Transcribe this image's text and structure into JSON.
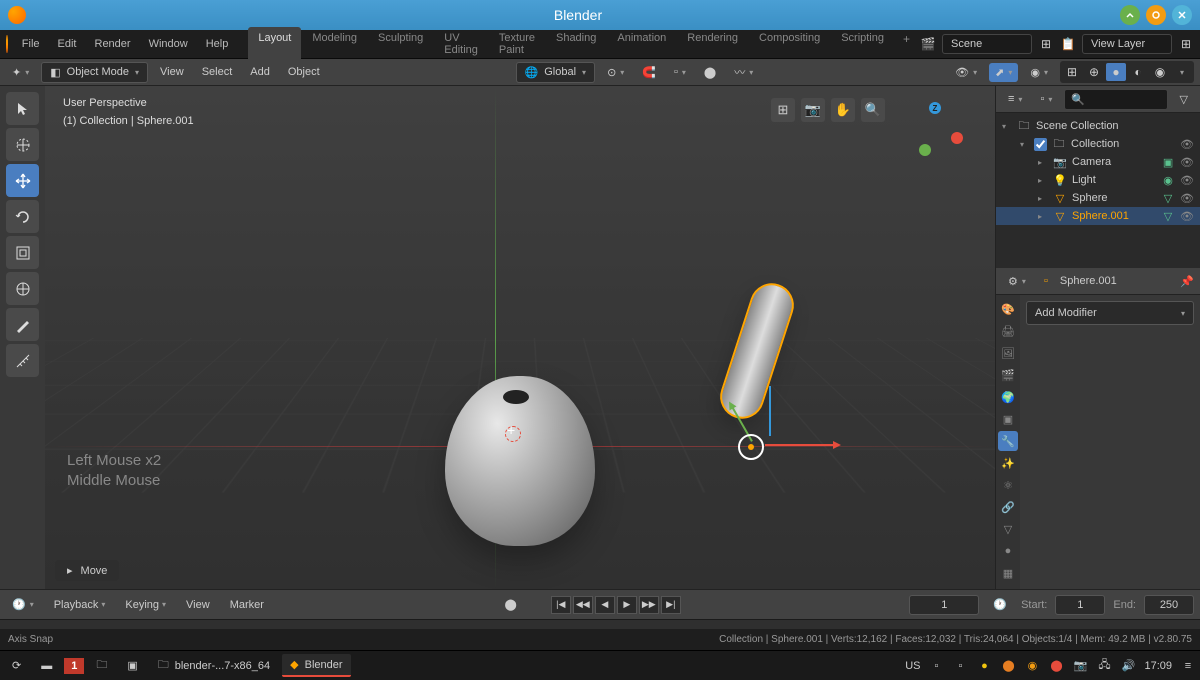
{
  "window": {
    "title": "Blender"
  },
  "menu": {
    "file": "File",
    "edit": "Edit",
    "render": "Render",
    "window": "Window",
    "help": "Help"
  },
  "workspaces": {
    "layout": "Layout",
    "modeling": "Modeling",
    "sculpting": "Sculpting",
    "uv": "UV Editing",
    "texture": "Texture Paint",
    "shading": "Shading",
    "animation": "Animation",
    "rendering": "Rendering",
    "compositing": "Compositing",
    "scripting": "Scripting"
  },
  "scene": {
    "label": "Scene",
    "layer": "View Layer"
  },
  "header": {
    "mode": "Object Mode",
    "view": "View",
    "select": "Select",
    "add": "Add",
    "object": "Object",
    "orientation": "Global"
  },
  "viewport": {
    "perspective": "User Perspective",
    "collection": "(1) Collection | Sphere.001",
    "hint1": "Left Mouse x2",
    "hint2": "Middle Mouse",
    "operator": "Move"
  },
  "outliner": {
    "root": "Scene Collection",
    "collection": "Collection",
    "items": [
      {
        "name": "Camera",
        "type": "camera"
      },
      {
        "name": "Light",
        "type": "light"
      },
      {
        "name": "Sphere",
        "type": "mesh"
      },
      {
        "name": "Sphere.001",
        "type": "mesh",
        "selected": true
      }
    ]
  },
  "properties": {
    "object_name": "Sphere.001",
    "add_modifier": "Add Modifier"
  },
  "timeline": {
    "playback": "Playback",
    "keying": "Keying",
    "view": "View",
    "marker": "Marker",
    "current": "1",
    "start_label": "Start:",
    "start": "1",
    "end_label": "End:",
    "end": "250"
  },
  "status": {
    "left": "Axis Snap",
    "right": "Collection | Sphere.001 | Verts:12,162 | Faces:12,032 | Tris:24,064 | Objects:1/4 | Mem: 49.2 MB | v2.80.75"
  },
  "taskbar": {
    "ws": "1",
    "file_mgr": "blender-...7-x86_64",
    "app": "Blender",
    "lang": "US",
    "time": "17:09"
  }
}
